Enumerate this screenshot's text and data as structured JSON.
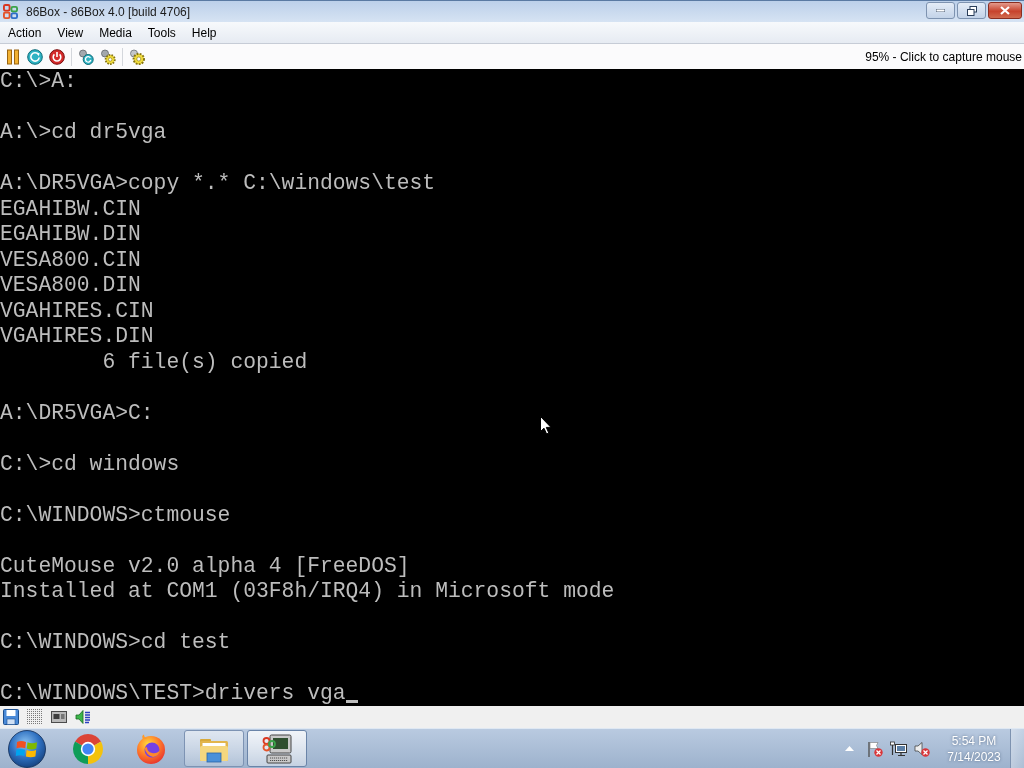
{
  "window": {
    "title": "86Box - 86Box 4.0 [build 4706]"
  },
  "menu_bar": [
    "Action",
    "View",
    "Media",
    "Tools",
    "Help"
  ],
  "toolbar": {
    "status_text": "95% - Click to capture mouse"
  },
  "console": {
    "blocks": [
      [
        {
          "text": "C:\\>A:",
          "kind": "text"
        }
      ],
      [
        {
          "text": "A:\\>cd dr5vga",
          "kind": "text"
        }
      ],
      [
        {
          "text": "A:\\DR5VGA>copy *.* C:\\windows\\test",
          "kind": "text"
        },
        {
          "text": "EGAHIBW.CIN",
          "kind": "text"
        },
        {
          "text": "EGAHIBW.DIN",
          "kind": "text"
        },
        {
          "text": "VESA800.CIN",
          "kind": "text"
        },
        {
          "text": "VESA800.DIN",
          "kind": "text"
        },
        {
          "text": "VGAHIRES.CIN",
          "kind": "text"
        },
        {
          "text": "VGAHIRES.DIN",
          "kind": "text"
        },
        {
          "text": "6 file(s) copied",
          "kind": "tabbed"
        }
      ],
      [
        {
          "text": "A:\\DR5VGA>C:",
          "kind": "text"
        }
      ],
      [
        {
          "text": "C:\\>cd windows",
          "kind": "text"
        }
      ],
      [
        {
          "text": "C:\\WINDOWS>ctmouse",
          "kind": "text"
        }
      ],
      [
        {
          "text": "CuteMouse v2.0 alpha 4 [FreeDOS]",
          "kind": "text"
        },
        {
          "text": "Installed at COM1 (03F8h/IRQ4) in Microsoft mode",
          "kind": "text"
        }
      ],
      [
        {
          "text": "C:\\WINDOWS>cd test",
          "kind": "text"
        }
      ]
    ],
    "current_line": "C:\\WINDOWS\\TEST>drivers vga"
  },
  "taskbar": {
    "buttons": [
      {
        "kind": "chrome",
        "running": false,
        "selected": false
      },
      {
        "kind": "firefox",
        "running": false,
        "selected": false
      },
      {
        "kind": "folder",
        "running": true,
        "selected": false
      },
      {
        "kind": "emulator",
        "running": true,
        "selected": true
      }
    ],
    "clock": {
      "time": "5:54 PM",
      "date": "7/14/2023"
    }
  }
}
